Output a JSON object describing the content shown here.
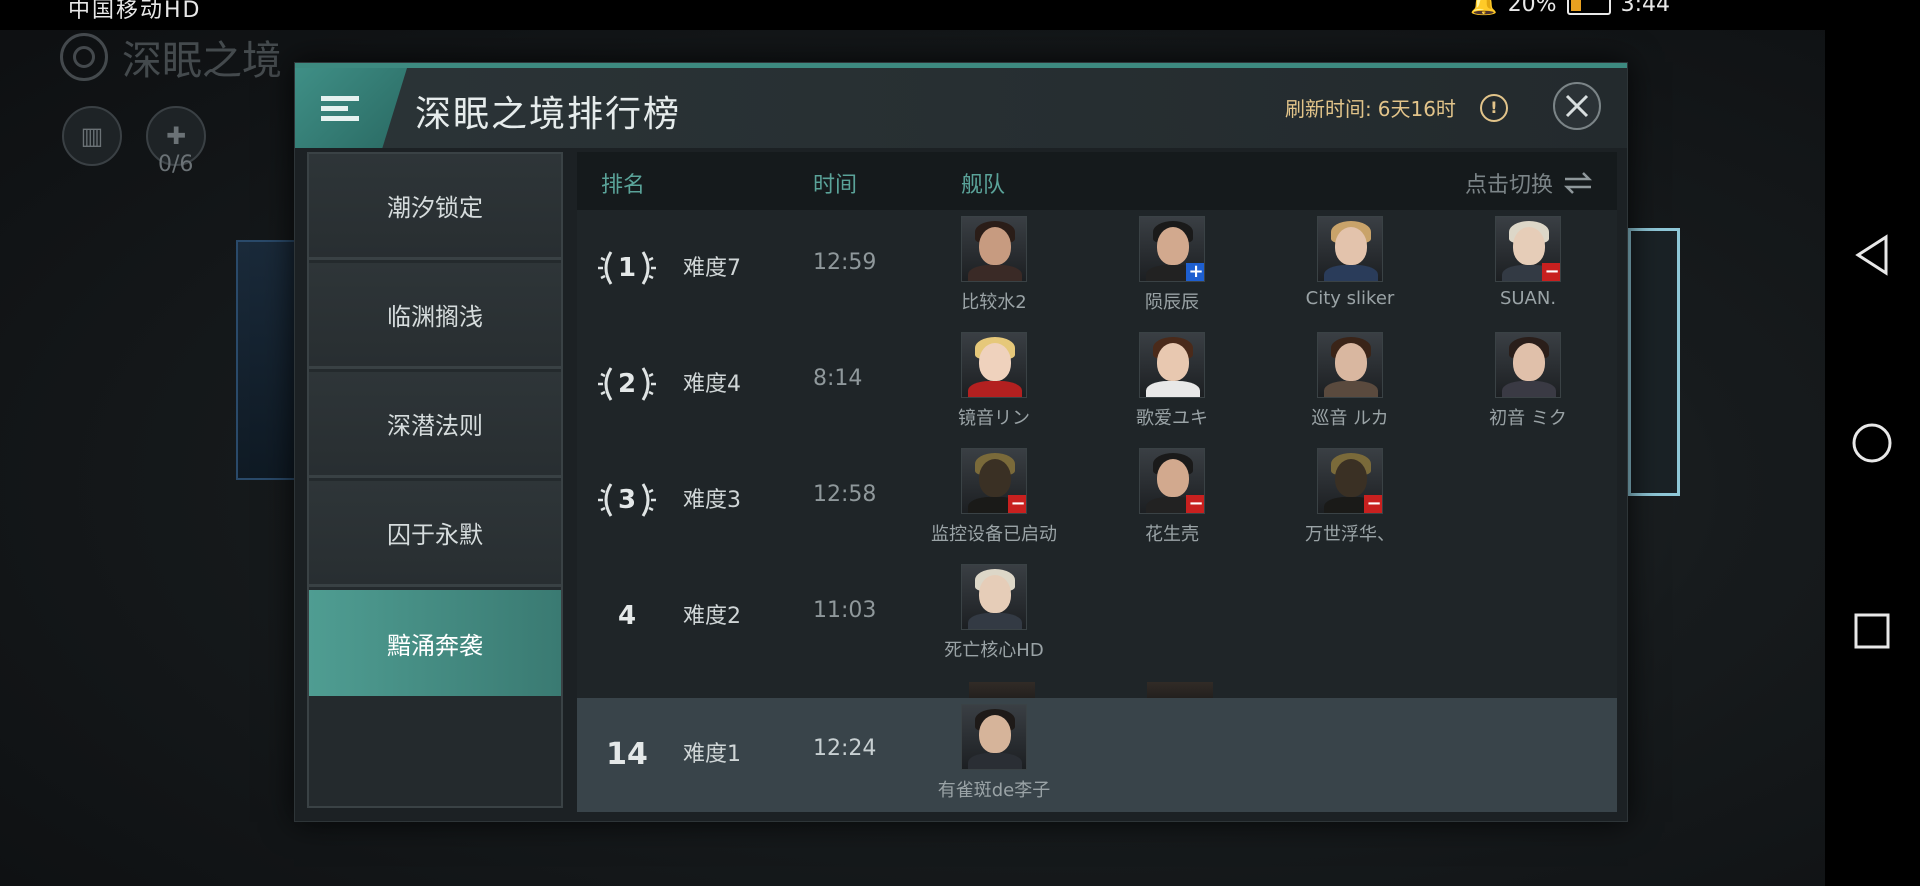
{
  "status_bar": {
    "carrier": "中国移动HD",
    "battery": "20%",
    "time": "3:44"
  },
  "background": {
    "title": "深眠之境",
    "counter": "0/6"
  },
  "dialog": {
    "title": "深眠之境排行榜",
    "refresh_label": "刷新时间:",
    "refresh_value": "6天16时",
    "refresh_icon": "!"
  },
  "sidebar": {
    "items": [
      {
        "label": "潮汐锁定"
      },
      {
        "label": "临渊搁浅"
      },
      {
        "label": "深潜法则"
      },
      {
        "label": "囚于永默"
      },
      {
        "label": "黯涌奔袭",
        "active": true
      }
    ]
  },
  "table": {
    "headers": {
      "rank": "排名",
      "time": "时间",
      "fleet": "舰队",
      "switch": "点击切换"
    },
    "rows": [
      {
        "rank": "1",
        "difficulty": "难度7",
        "time": "12:59",
        "members": [
          {
            "name": "比较水2",
            "badge": ""
          },
          {
            "name": "陨辰辰",
            "badge": "+"
          },
          {
            "name": "City sliker",
            "badge": ""
          },
          {
            "name": "SUAN.",
            "badge": "−"
          }
        ]
      },
      {
        "rank": "2",
        "difficulty": "难度4",
        "time": "8:14",
        "members": [
          {
            "name": "镜音リン",
            "badge": ""
          },
          {
            "name": "歌爱ユキ",
            "badge": ""
          },
          {
            "name": "巡音 ルカ",
            "badge": ""
          },
          {
            "name": "初音 ミク",
            "badge": ""
          }
        ]
      },
      {
        "rank": "3",
        "difficulty": "难度3",
        "time": "12:58",
        "members": [
          {
            "name": "监控设备已启动",
            "badge": "−"
          },
          {
            "name": "花生壳",
            "badge": "−"
          },
          {
            "name": "万世浮华、",
            "badge": "−"
          }
        ]
      },
      {
        "rank": "4",
        "difficulty": "难度2",
        "time": "11:03",
        "members": [
          {
            "name": "死亡核心HD",
            "badge": ""
          }
        ]
      }
    ],
    "my_row": {
      "rank": "14",
      "difficulty": "难度1",
      "time": "12:24",
      "members": [
        {
          "name": "有雀斑de李子",
          "badge": ""
        }
      ]
    }
  },
  "colors": {
    "accent": "#4f9d92",
    "gold": "#e2c48a",
    "minus_badge": "#c8201f",
    "plus_badge": "#1e5fd0"
  }
}
